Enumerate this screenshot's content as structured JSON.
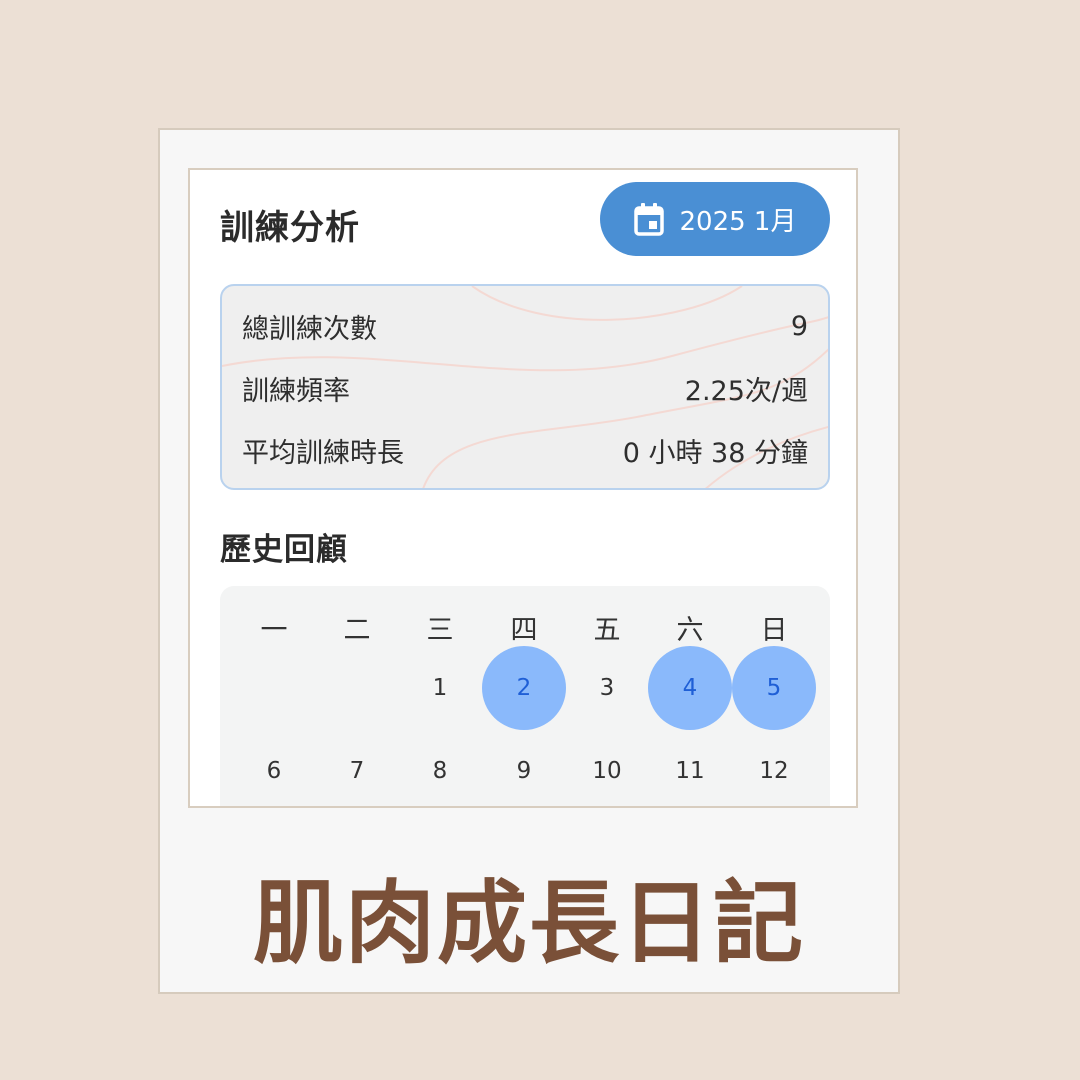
{
  "header": {
    "title": "訓練分析",
    "month_label": "2025 1月",
    "month_icon": "calendar-icon",
    "accent_color": "#4a8fd4"
  },
  "stats": [
    {
      "label": "總訓練次數",
      "value": "9"
    },
    {
      "label": "訓練頻率",
      "value": "2.25次/週"
    },
    {
      "label": "平均訓練時長",
      "value": "0 小時 38 分鐘"
    }
  ],
  "history": {
    "title": "歷史回顧",
    "weekdays": [
      "一",
      "二",
      "三",
      "四",
      "五",
      "六",
      "日"
    ],
    "days": [
      "1",
      "2",
      "3",
      "4",
      "5",
      "6",
      "7",
      "8",
      "9",
      "10",
      "11",
      "12"
    ],
    "active_days": [
      "2",
      "4",
      "5"
    ],
    "active_color": "#8ab9fb"
  },
  "brand": {
    "title": "肌肉成長日記",
    "color": "#7a5038"
  }
}
